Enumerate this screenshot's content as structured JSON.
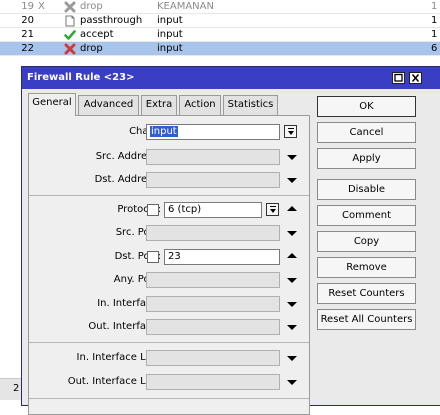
{
  "rules": [
    {
      "num": "19",
      "flag": "X",
      "icon": "drop-icon",
      "action": "drop",
      "chain": "KEAMANAN",
      "end": "1",
      "faded": true,
      "selected": false
    },
    {
      "num": "20",
      "flag": "",
      "icon": "passthrough-icon",
      "action": "passthrough",
      "chain": "input",
      "end": "1",
      "faded": false,
      "selected": false
    },
    {
      "num": "21",
      "flag": "",
      "icon": "accept-icon",
      "action": "accept",
      "chain": "input",
      "end": "1",
      "faded": false,
      "selected": false
    },
    {
      "num": "22",
      "flag": "",
      "icon": "drop-icon",
      "action": "drop",
      "chain": "input",
      "end": "6",
      "faded": false,
      "selected": true
    }
  ],
  "status_bar_text": "2",
  "dialog": {
    "title": "Firewall Rule <23>",
    "min_label": "□",
    "close_label": "✕",
    "tabs": [
      "General",
      "Advanced",
      "Extra",
      "Action",
      "Statistics"
    ],
    "active_tab": "General",
    "fields": {
      "chain": {
        "label": "Chain:",
        "value": "input"
      },
      "src_address": {
        "label": "Src. Address:",
        "value": ""
      },
      "dst_address": {
        "label": "Dst. Address:",
        "value": ""
      },
      "protocol": {
        "label": "Protocol:",
        "value": "6 (tcp)"
      },
      "src_port": {
        "label": "Src. Port:",
        "value": ""
      },
      "dst_port": {
        "label": "Dst. Port:",
        "value": "23"
      },
      "any_port": {
        "label": "Any. Port:",
        "value": ""
      },
      "in_interface": {
        "label": "In. Interface:",
        "value": ""
      },
      "out_interface": {
        "label": "Out. Interface:",
        "value": ""
      },
      "in_interface_list": {
        "label": "In. Interface List:",
        "value": ""
      },
      "out_interface_list": {
        "label": "Out. Interface List:",
        "value": ""
      }
    },
    "buttons": {
      "ok": "OK",
      "cancel": "Cancel",
      "apply": "Apply",
      "disable": "Disable",
      "comment": "Comment",
      "copy": "Copy",
      "remove": "Remove",
      "reset_counters": "Reset Counters",
      "reset_all_counters": "Reset All Counters"
    }
  },
  "colors": {
    "titlebar": "#3a3ec2",
    "selected_row": "#a9c4ea",
    "drop": "#d03a3a",
    "accept": "#2fa832"
  }
}
